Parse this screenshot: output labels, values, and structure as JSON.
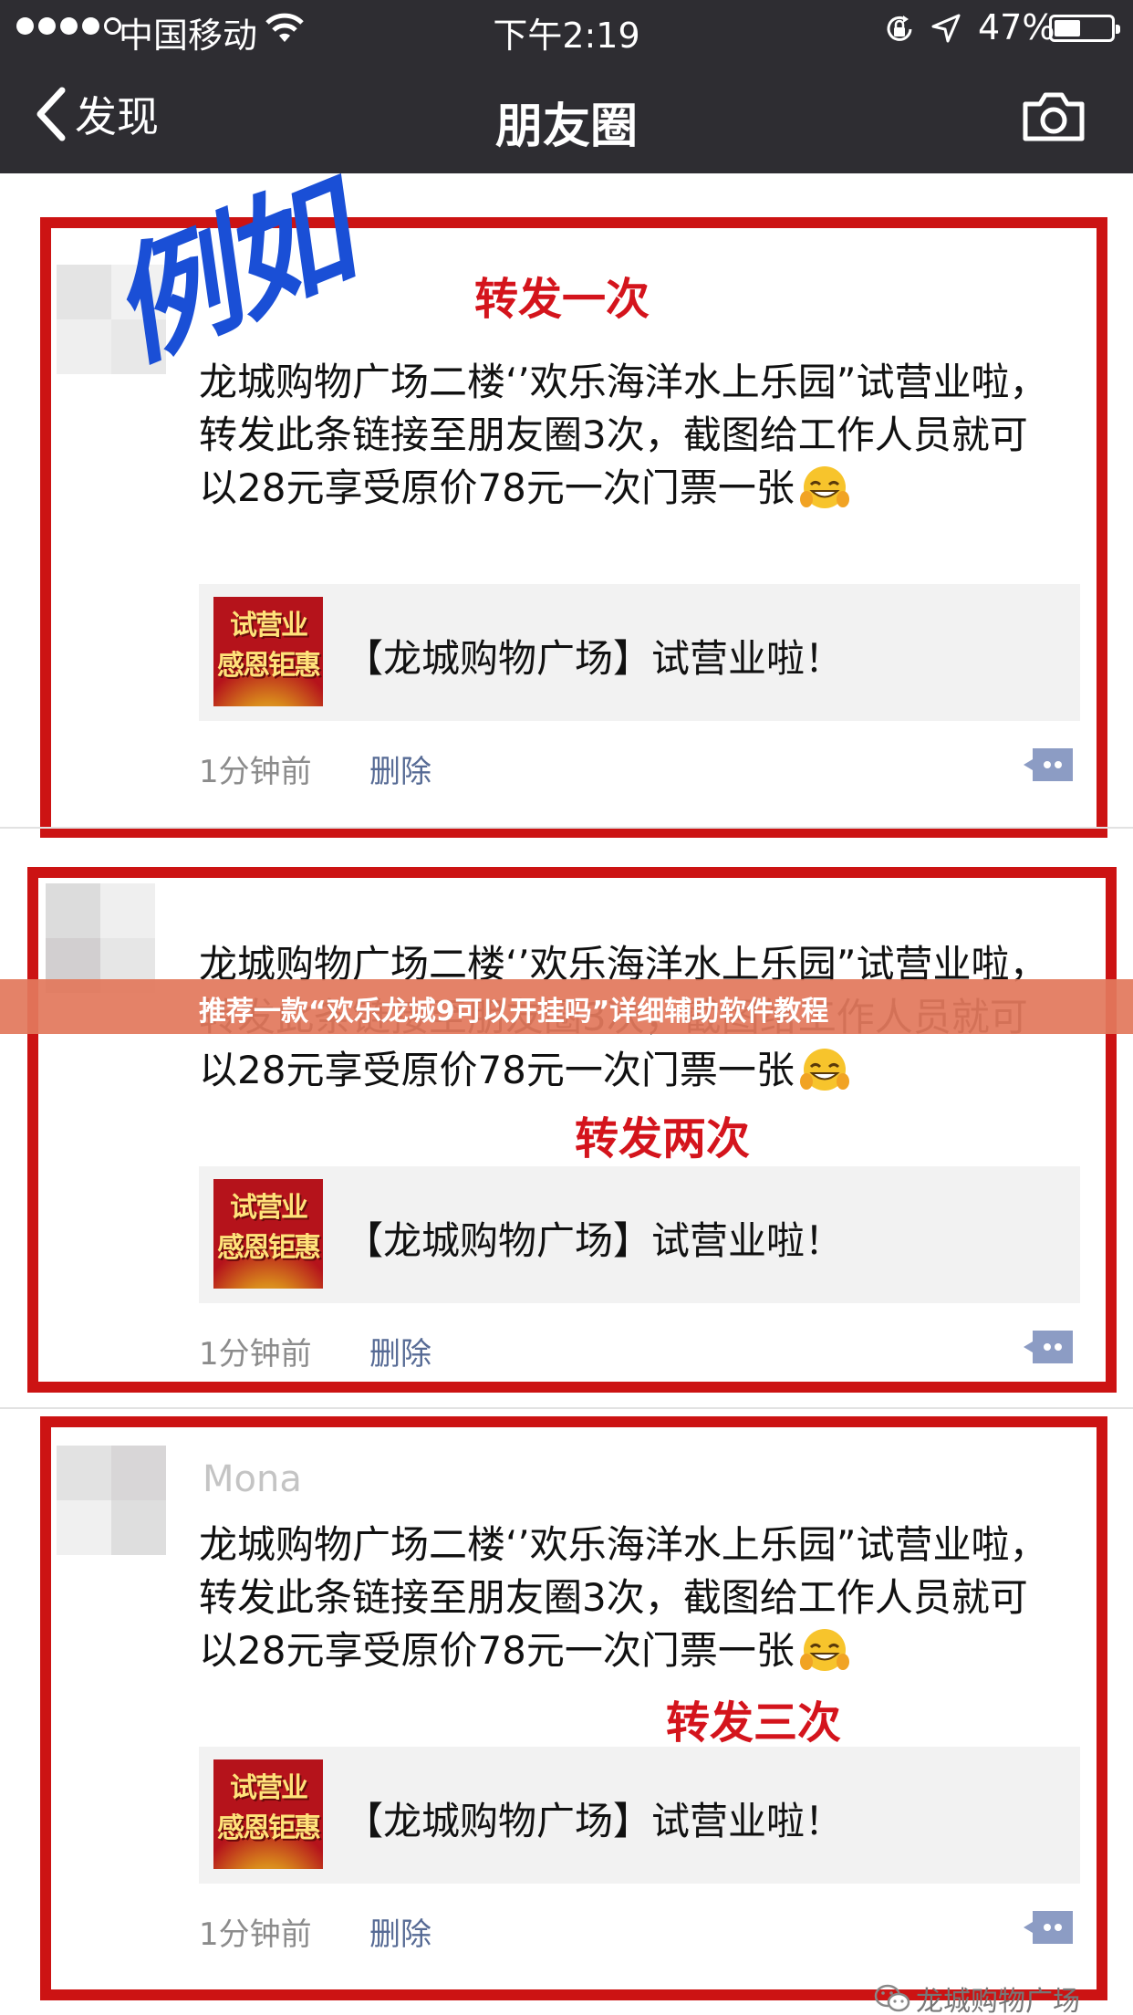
{
  "status_bar": {
    "carrier": "中国移动",
    "time": "下午2:19",
    "battery_percent": "47%",
    "battery_level": 0.47
  },
  "nav": {
    "back_label": "发现",
    "title": "朋友圈"
  },
  "annotation": "例如",
  "banner": "推荐一款“欢乐龙城9可以开挂吗”详细辅助软件教程",
  "posts": [
    {
      "username": "",
      "text": "龙城购物广场二楼‘’欢乐海洋水上乐园”试营业啦，转发此条链接至朋友圈3次，截图给工作人员就可以28元享受原价78元一次门票一张",
      "link_title": "【龙城购物广场】试营业啦！",
      "thumb_text_line1": "试营业",
      "thumb_text_line2": "感恩钜惠",
      "time": "1分钟前",
      "delete": "删除",
      "forward_label": "转发一次"
    },
    {
      "username": "",
      "text": "龙城购物广场二楼‘’欢乐海洋水上乐园”试营业啦，转发此条链接至朋友圈3次，截图给工作人员就可以28元享受原价78元一次门票一张",
      "link_title": "【龙城购物广场】试营业啦！",
      "thumb_text_line1": "试营业",
      "thumb_text_line2": "感恩钜惠",
      "time": "1分钟前",
      "delete": "删除",
      "forward_label": "转发两次"
    },
    {
      "username": "Mona",
      "text": "龙城购物广场二楼‘’欢乐海洋水上乐园”试营业啦，转发此条链接至朋友圈3次，截图给工作人员就可以28元享受原价78元一次门票一张",
      "link_title": "【龙城购物广场】试营业啦！",
      "thumb_text_line1": "试营业",
      "thumb_text_line2": "感恩钜惠",
      "time": "1分钟前",
      "delete": "删除",
      "forward_label": "转发三次"
    }
  ],
  "watermark": "龙城购物广场",
  "icons": {
    "back": "chevron-left-icon",
    "camera": "camera-icon",
    "comment": "comment-bubble-icon",
    "wifi": "wifi-icon",
    "rotation_lock": "rotation-lock-icon",
    "location": "location-arrow-icon",
    "emoji": "grin-emoji-icon",
    "wechat": "wechat-icon"
  },
  "colors": {
    "nav_background": "#2e2d32",
    "highlight_box": "#cc1313",
    "annotation_text": "#1a4fd6",
    "forward_label": "#d4141c",
    "delete_link": "#576b95",
    "banner": "#e2785c"
  }
}
